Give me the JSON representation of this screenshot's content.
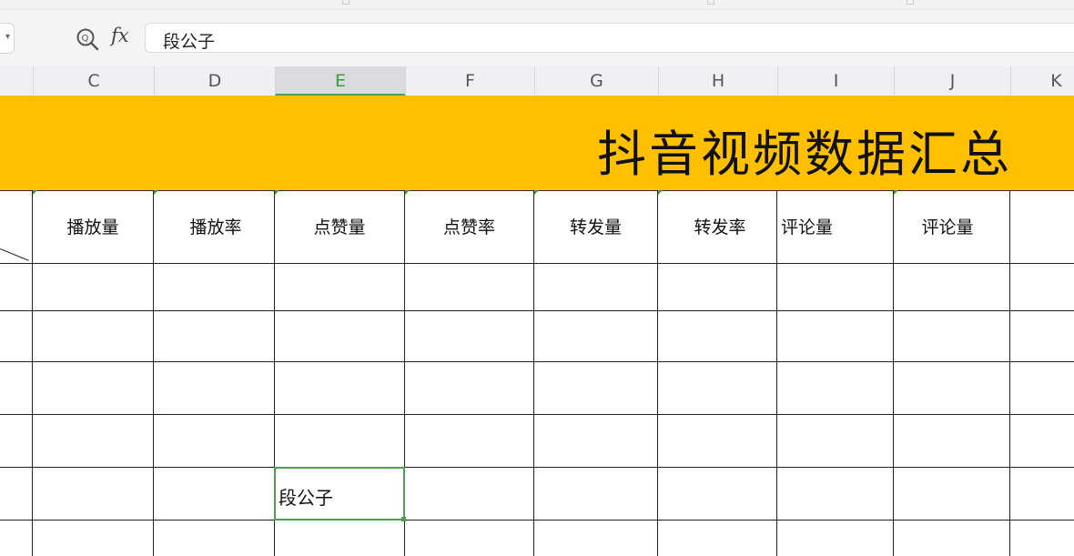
{
  "formula_bar": {
    "formula_value": "段公子",
    "zoom_icon": "zoom-icon",
    "fx_label": "fx"
  },
  "columns": [
    "C",
    "D",
    "E",
    "F",
    "G",
    "H",
    "I",
    "J",
    "K"
  ],
  "active_column": "E",
  "title": "抖音视频数据汇总",
  "table_headers": [
    "播放量",
    "播放率",
    "点赞量",
    "点赞率",
    "转发量",
    "转发率",
    "评论量",
    "评论量"
  ],
  "selected_cell": {
    "ref": "E",
    "value": "段公子"
  },
  "colors": {
    "title_band": "#ffc000",
    "selection": "#4aa14e"
  }
}
